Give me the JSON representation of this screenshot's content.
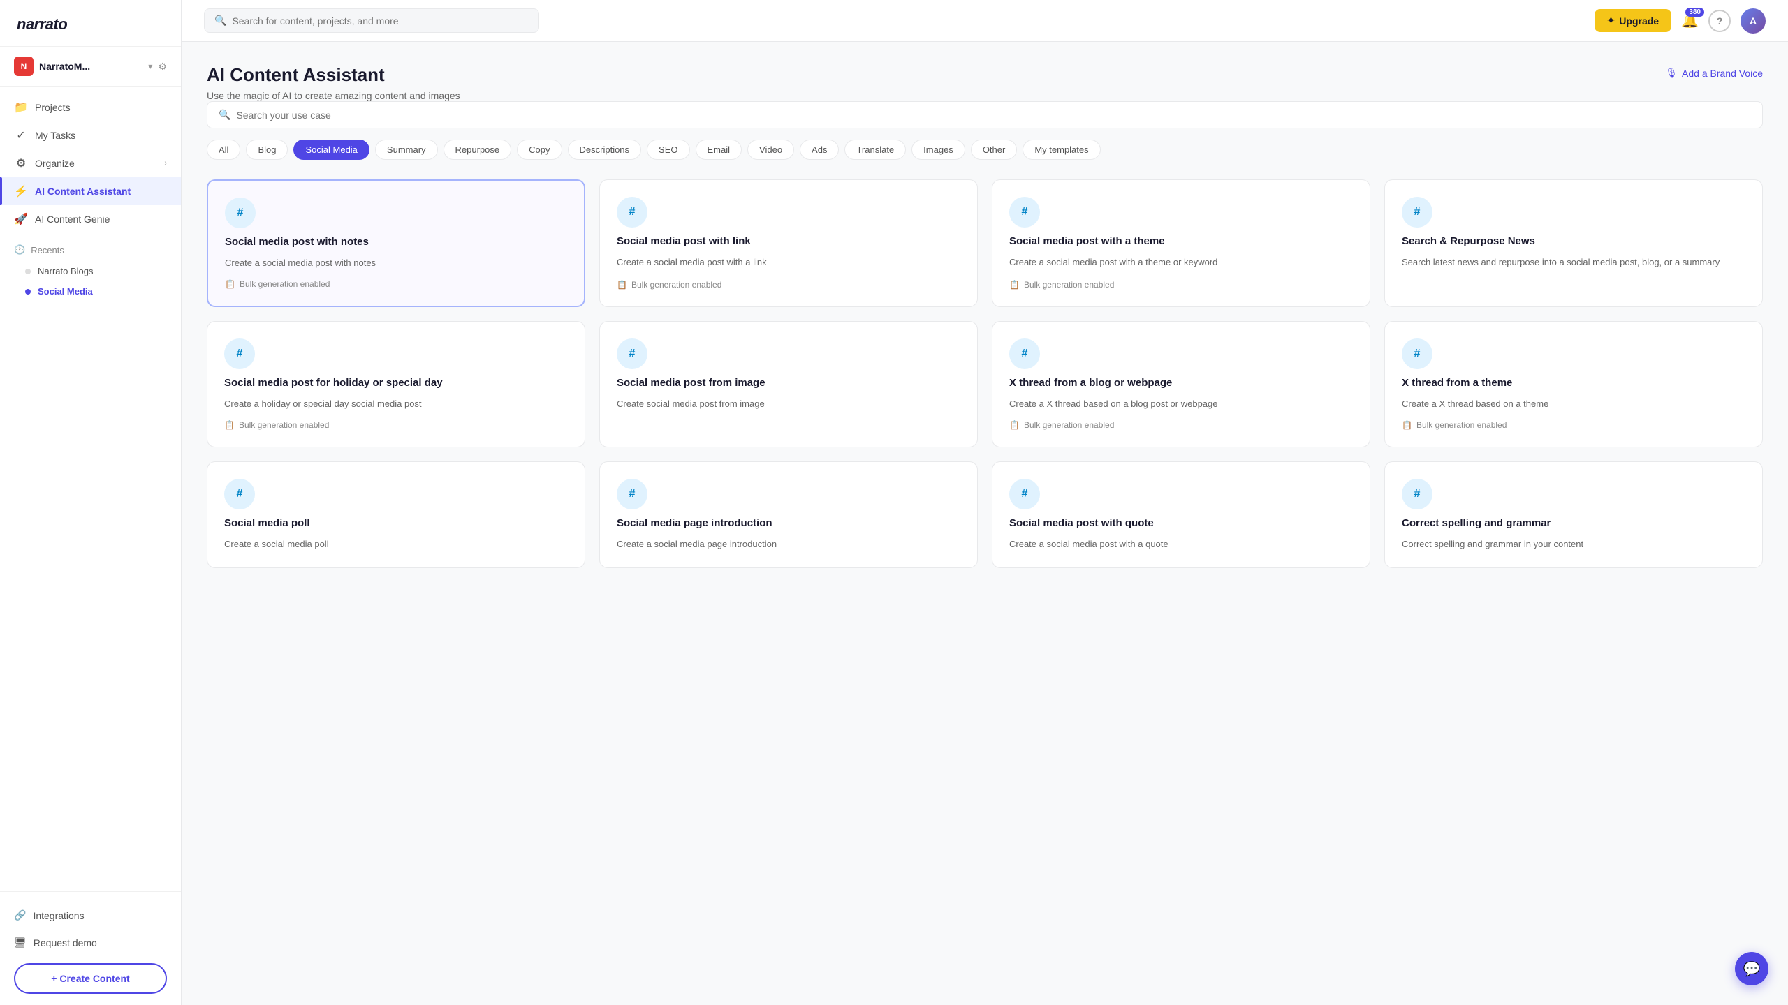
{
  "app": {
    "logo": "narrato",
    "workspace": {
      "initial": "N",
      "name": "NarratoM...",
      "avatar_color": "#e53935"
    }
  },
  "sidebar": {
    "nav_items": [
      {
        "id": "projects",
        "label": "Projects",
        "icon": "📁"
      },
      {
        "id": "my-tasks",
        "label": "My Tasks",
        "icon": "✓"
      },
      {
        "id": "organize",
        "label": "Organize",
        "icon": "⚙",
        "has_arrow": true
      },
      {
        "id": "ai-content-assistant",
        "label": "AI Content Assistant",
        "icon": "⚡",
        "active": true
      },
      {
        "id": "ai-content-genie",
        "label": "AI Content Genie",
        "icon": "🚀"
      }
    ],
    "recents_label": "Recents",
    "recent_items": [
      {
        "id": "narrato-blogs",
        "label": "Narrato Blogs",
        "active": false
      },
      {
        "id": "social-media",
        "label": "Social Media",
        "active": true
      }
    ],
    "bottom_links": [
      {
        "id": "integrations",
        "label": "Integrations",
        "icon": "🔗"
      },
      {
        "id": "request-demo",
        "label": "Request demo",
        "icon": "🖥"
      }
    ],
    "create_btn_label": "+ Create Content"
  },
  "header": {
    "search_placeholder": "Search for content, projects, and more",
    "upgrade_label": "Upgrade",
    "notification_count": "380",
    "help_icon": "?",
    "avatar_initials": "A"
  },
  "page": {
    "title": "AI Content Assistant",
    "subtitle": "Use the magic of AI to create amazing content and images",
    "brand_voice_label": "Add a Brand Voice",
    "search_placeholder": "Search your use case",
    "filter_tags": [
      {
        "id": "all",
        "label": "All",
        "active": false
      },
      {
        "id": "blog",
        "label": "Blog",
        "active": false
      },
      {
        "id": "social-media",
        "label": "Social Media",
        "active": true
      },
      {
        "id": "summary",
        "label": "Summary",
        "active": false
      },
      {
        "id": "repurpose",
        "label": "Repurpose",
        "active": false
      },
      {
        "id": "copy",
        "label": "Copy",
        "active": false
      },
      {
        "id": "descriptions",
        "label": "Descriptions",
        "active": false
      },
      {
        "id": "seo",
        "label": "SEO",
        "active": false
      },
      {
        "id": "email",
        "label": "Email",
        "active": false
      },
      {
        "id": "video",
        "label": "Video",
        "active": false
      },
      {
        "id": "ads",
        "label": "Ads",
        "active": false
      },
      {
        "id": "translate",
        "label": "Translate",
        "active": false
      },
      {
        "id": "images",
        "label": "Images",
        "active": false
      },
      {
        "id": "other",
        "label": "Other",
        "active": false
      },
      {
        "id": "my-templates",
        "label": "My templates",
        "active": false
      }
    ]
  },
  "cards": [
    {
      "id": "post-with-notes",
      "title": "Social media post with notes",
      "desc": "Create a social media post with notes",
      "bulk": "Bulk generation enabled",
      "selected": true,
      "icon_color": "#e0f2fe",
      "text_color": "#0284c7"
    },
    {
      "id": "post-with-link",
      "title": "Social media post with link",
      "desc": "Create a social media post with a link",
      "bulk": "Bulk generation enabled",
      "selected": false,
      "icon_color": "#e0f2fe",
      "text_color": "#0284c7"
    },
    {
      "id": "post-with-theme",
      "title": "Social media post with a theme",
      "desc": "Create a social media post with a theme or keyword",
      "bulk": "Bulk generation enabled",
      "selected": false,
      "icon_color": "#e0f2fe",
      "text_color": "#0284c7"
    },
    {
      "id": "search-repurpose-news",
      "title": "Search & Repurpose News",
      "desc": "Search latest news and repurpose into a social media post, blog, or a summary",
      "bulk": null,
      "selected": false,
      "icon_color": "#e0f2fe",
      "text_color": "#0284c7"
    },
    {
      "id": "holiday-special-day",
      "title": "Social media post for holiday or special day",
      "desc": "Create a holiday or special day social media post",
      "bulk": "Bulk generation enabled",
      "selected": false,
      "icon_color": "#e0f2fe",
      "text_color": "#0284c7"
    },
    {
      "id": "post-from-image",
      "title": "Social media post from image",
      "desc": "Create social media post from image",
      "bulk": null,
      "selected": false,
      "icon_color": "#e0f2fe",
      "text_color": "#0284c7"
    },
    {
      "id": "x-thread-blog",
      "title": "X thread from a blog or webpage",
      "desc": "Create a X thread based on a blog post or webpage",
      "bulk": "Bulk generation enabled",
      "selected": false,
      "icon_color": "#e0f2fe",
      "text_color": "#0284c7"
    },
    {
      "id": "x-thread-theme",
      "title": "X thread from a theme",
      "desc": "Create a X thread based on a theme",
      "bulk": "Bulk generation enabled",
      "selected": false,
      "icon_color": "#e0f2fe",
      "text_color": "#0284c7"
    },
    {
      "id": "social-media-poll",
      "title": "Social media poll",
      "desc": "Create a social media poll",
      "bulk": null,
      "selected": false,
      "icon_color": "#e0f2fe",
      "text_color": "#0284c7"
    },
    {
      "id": "social-media-page-intro",
      "title": "Social media page introduction",
      "desc": "Create a social media page introduction",
      "bulk": null,
      "selected": false,
      "icon_color": "#e0f2fe",
      "text_color": "#0284c7"
    },
    {
      "id": "post-with-quote",
      "title": "Social media post with quote",
      "desc": "Create a social media post with a quote",
      "bulk": null,
      "selected": false,
      "icon_color": "#e0f2fe",
      "text_color": "#0284c7"
    },
    {
      "id": "correct-spelling-grammar",
      "title": "Correct spelling and grammar",
      "desc": "Correct spelling and grammar in your content",
      "bulk": null,
      "selected": false,
      "icon_color": "#e0f2fe",
      "text_color": "#0284c7"
    }
  ]
}
